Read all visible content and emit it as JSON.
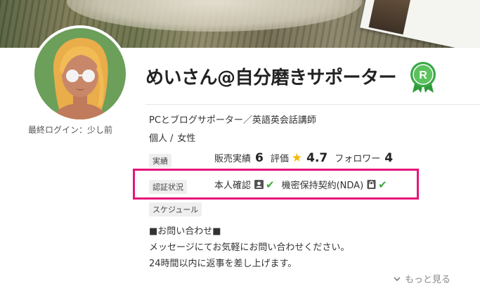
{
  "profile": {
    "name": "めいさん@自分磨きサポーター",
    "rank_badge": "R",
    "last_login": "最終ログイン：少し前",
    "catchphrase": "PCとブログサポーター／英語英会話講師",
    "type": "個人",
    "separator": "/",
    "gender": "女性"
  },
  "stats": {
    "tag": "実績",
    "sales_label": "販売実績",
    "sales_value": "6",
    "rating_label": "評価",
    "rating_value": "4.7",
    "followers_label": "フォロワー",
    "followers_value": "4"
  },
  "certification": {
    "tag": "認証状況",
    "identity_label": "本人確認",
    "nda_label": "機密保持契約(NDA)",
    "check_mark": "✔"
  },
  "schedule": {
    "tag": "スケジュール"
  },
  "message": {
    "line1": "■お問い合わせ■",
    "line2": "メッセージにてお気軽にお問い合わせください。",
    "line3": "24時間以内に返事を差し上げます。"
  },
  "show_more": "もっと見る",
  "colors": {
    "highlight_border": "#e6157a",
    "check": "#3ba83b",
    "star": "#f5b90a",
    "badge_green": "#2e9a3a"
  },
  "icons": {
    "star": "star-icon",
    "identity": "id-card-icon",
    "nda": "lock-icon",
    "check": "check-icon",
    "more": "chevron-down-icon"
  }
}
